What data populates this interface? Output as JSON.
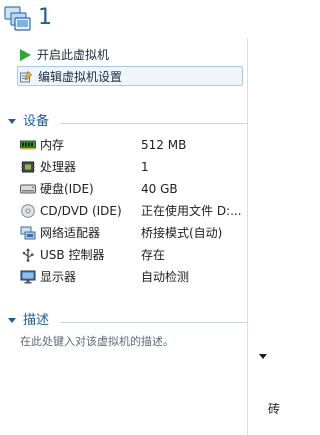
{
  "vm": {
    "title": "1"
  },
  "actions": [
    {
      "label": "开启此虚拟机",
      "icon": "play-icon"
    },
    {
      "label": "编辑虚拟机设置",
      "icon": "edit-settings-icon"
    }
  ],
  "devices_section": {
    "title": "设备"
  },
  "devices": [
    {
      "name": "内存",
      "value": "512 MB",
      "icon": "memory-icon"
    },
    {
      "name": "处理器",
      "value": "1",
      "icon": "processor-icon"
    },
    {
      "name": "硬盘(IDE)",
      "value": "40 GB",
      "icon": "hard-disk-icon"
    },
    {
      "name": "CD/DVD (IDE)",
      "value": "正在使用文件 D:...",
      "icon": "cd-dvd-icon"
    },
    {
      "name": "网络适配器",
      "value": "桥接模式(自动)",
      "icon": "network-adapter-icon"
    },
    {
      "name": "USB 控制器",
      "value": "存在",
      "icon": "usb-icon"
    },
    {
      "name": "显示器",
      "value": "自动检测",
      "icon": "display-icon"
    }
  ],
  "description_section": {
    "title": "描述",
    "placeholder": "在此处键入对该虚拟机的描述。"
  },
  "right_panel": {
    "partial_text": "砖"
  },
  "colors": {
    "accent": "#1f5c99",
    "selection_bg": "#eef5fc",
    "selection_border": "#a9cbe8"
  }
}
